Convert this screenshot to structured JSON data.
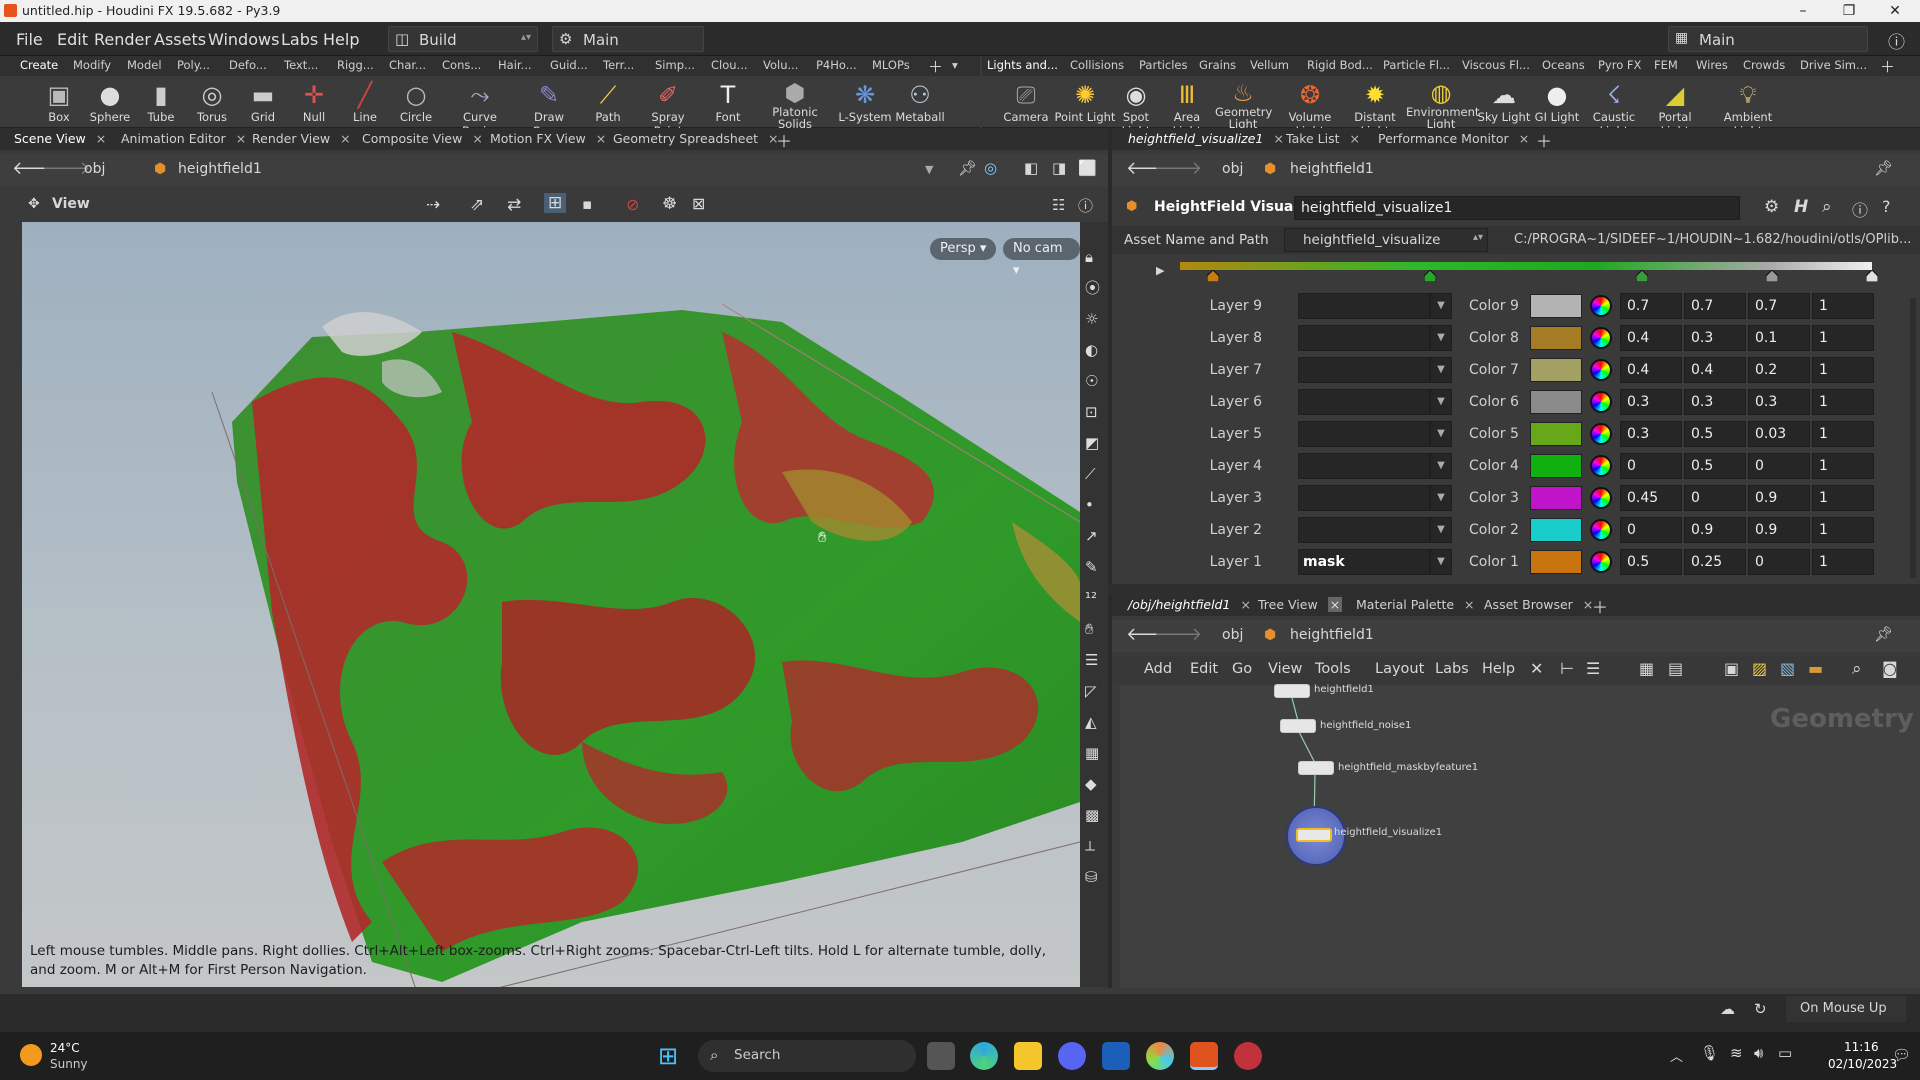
{
  "window": {
    "title": "untitled.hip - Houdini FX 19.5.682 - Py3.9",
    "controls": [
      "–",
      "❐",
      "✕"
    ]
  },
  "menubar": {
    "items": [
      "File",
      "Edit",
      "Render",
      "Assets",
      "Windows",
      "Labs",
      "Help"
    ],
    "desktop": "Build",
    "context": "Main",
    "right_desktop": "Main"
  },
  "shelf_left": {
    "tabs": [
      "Create",
      "Modify",
      "Model",
      "Poly...",
      "Defo...",
      "Text...",
      "Rigg...",
      "Char...",
      "Cons...",
      "Hair...",
      "Guid...",
      "Terr...",
      "Simp...",
      "Clou...",
      "Volu...",
      "P4Ho...",
      "MLOPs"
    ],
    "tools": [
      {
        "label": "Box",
        "icon": "box-icon"
      },
      {
        "label": "Sphere",
        "icon": "sphere-icon"
      },
      {
        "label": "Tube",
        "icon": "tube-icon"
      },
      {
        "label": "Torus",
        "icon": "torus-icon"
      },
      {
        "label": "Grid",
        "icon": "grid-icon"
      },
      {
        "label": "Null",
        "icon": "null-icon"
      },
      {
        "label": "Line",
        "icon": "line-icon"
      },
      {
        "label": "Circle",
        "icon": "circle-icon"
      },
      {
        "label": "Curve Bezier",
        "icon": "curve-bezier-icon"
      },
      {
        "label": "Draw Curve",
        "icon": "draw-curve-icon"
      },
      {
        "label": "Path",
        "icon": "path-icon"
      },
      {
        "label": "Spray Paint",
        "icon": "spray-paint-icon"
      },
      {
        "label": "Font",
        "icon": "font-icon"
      },
      {
        "label": "Platonic Solids",
        "icon": "platonic-icon"
      },
      {
        "label": "L-System",
        "icon": "lsystem-icon"
      },
      {
        "label": "Metaball",
        "icon": "metaball-icon"
      }
    ]
  },
  "shelf_right": {
    "tabs": [
      "Lights and...",
      "Collisions",
      "Particles",
      "Grains",
      "Vellum",
      "Rigid Bod...",
      "Particle Fl...",
      "Viscous Fl...",
      "Oceans",
      "Pyro FX",
      "FEM",
      "Wires",
      "Crowds",
      "Drive Sim..."
    ],
    "tools": [
      {
        "label": "Camera",
        "icon": "camera-icon"
      },
      {
        "label": "Point Light",
        "icon": "point-light-icon"
      },
      {
        "label": "Spot Light",
        "icon": "spot-light-icon"
      },
      {
        "label": "Area Light",
        "icon": "area-light-icon"
      },
      {
        "label": "Geometry Light",
        "icon": "geometry-light-icon"
      },
      {
        "label": "Volume Light",
        "icon": "volume-light-icon"
      },
      {
        "label": "Distant Light",
        "icon": "distant-light-icon"
      },
      {
        "label": "Environment Light",
        "icon": "environment-light-icon"
      },
      {
        "label": "Sky Light",
        "icon": "sky-light-icon"
      },
      {
        "label": "GI Light",
        "icon": "gi-light-icon"
      },
      {
        "label": "Caustic Light",
        "icon": "caustic-light-icon"
      },
      {
        "label": "Portal Light",
        "icon": "portal-light-icon"
      },
      {
        "label": "Ambient Light",
        "icon": "ambient-light-icon"
      }
    ]
  },
  "left_pane": {
    "tabs": [
      "Scene View",
      "Animation Editor",
      "Render View",
      "Composite View",
      "Motion FX View",
      "Geometry Spreadsheet"
    ],
    "path": [
      "obj",
      "heightfield1"
    ],
    "view_label": "View",
    "persp": "Persp ▾",
    "cam": "No cam ▾",
    "hint": "Left mouse tumbles. Middle pans. Right dollies. Ctrl+Alt+Left box-zooms. Ctrl+Right zooms. Spacebar-Ctrl-Left tilts. Hold L for alternate tumble, dolly, and zoom.    M or Alt+M for First Person Navigation."
  },
  "param_pane": {
    "tabs": [
      "heightfield_visualize1",
      "Take List",
      "Performance Monitor"
    ],
    "path": [
      "obj",
      "heightfield1"
    ],
    "node_type": "HeightField Visualize",
    "node_name": "heightfield_visualize1",
    "asset_label": "Asset Name and Path",
    "asset_name": "heightfield_visualize",
    "asset_path": "C:/PROGRA~1/SIDEEF~1/HOUDIN~1.682/houdini/otls/OPlib...",
    "ramp_keys": [
      "#c87c12",
      "#2aa52a",
      "#3a9b3a",
      "#9a9a9a",
      "#e0e0e0"
    ],
    "rows": [
      {
        "layer": "Layer 9",
        "value": "",
        "color_label": "Color 9",
        "swatch": "#b3b3b3",
        "r": "0.7",
        "g": "0.7",
        "b": "0.7",
        "a": "1"
      },
      {
        "layer": "Layer 8",
        "value": "",
        "color_label": "Color 8",
        "swatch": "#a47c25",
        "r": "0.4",
        "g": "0.3",
        "b": "0.1",
        "a": "1"
      },
      {
        "layer": "Layer 7",
        "value": "",
        "color_label": "Color 7",
        "swatch": "#a3a064",
        "r": "0.4",
        "g": "0.4",
        "b": "0.2",
        "a": "1"
      },
      {
        "layer": "Layer 6",
        "value": "",
        "color_label": "Color 6",
        "swatch": "#8a8a8a",
        "r": "0.3",
        "g": "0.3",
        "b": "0.3",
        "a": "1"
      },
      {
        "layer": "Layer 5",
        "value": "",
        "color_label": "Color 5",
        "swatch": "#66a81a",
        "r": "0.3",
        "g": "0.5",
        "b": "0.03",
        "a": "1"
      },
      {
        "layer": "Layer 4",
        "value": "",
        "color_label": "Color 4",
        "swatch": "#10b010",
        "r": "0",
        "g": "0.5",
        "b": "0",
        "a": "1"
      },
      {
        "layer": "Layer 3",
        "value": "",
        "color_label": "Color 3",
        "swatch": "#c014c8",
        "r": "0.45",
        "g": "0",
        "b": "0.9",
        "a": "1"
      },
      {
        "layer": "Layer 2",
        "value": "",
        "color_label": "Color 2",
        "swatch": "#18cccc",
        "r": "0",
        "g": "0.9",
        "b": "0.9",
        "a": "1"
      },
      {
        "layer": "Layer 1",
        "value": "mask",
        "color_label": "Color 1",
        "swatch": "#c8750f",
        "r": "0.5",
        "g": "0.25",
        "b": "0",
        "a": "1"
      }
    ]
  },
  "network_pane": {
    "tabs": [
      "/obj/heightfield1",
      "Tree View",
      "Material Palette",
      "Asset Browser"
    ],
    "path": [
      "obj",
      "heightfield1"
    ],
    "menu": [
      "Add",
      "Edit",
      "Go",
      "View",
      "Tools",
      "Layout",
      "Labs",
      "Help"
    ],
    "context_label": "Geometry",
    "nodes": [
      "heightfield1",
      "heightfield_noise1",
      "heightfield_maskbyfeature1",
      "heightfield_visualize1"
    ]
  },
  "status": {
    "update_mode": "On Mouse Up"
  },
  "taskbar": {
    "weather_temp": "24°C",
    "weather_desc": "Sunny",
    "search": "Search",
    "time": "11:16",
    "date": "02/10/2023"
  }
}
